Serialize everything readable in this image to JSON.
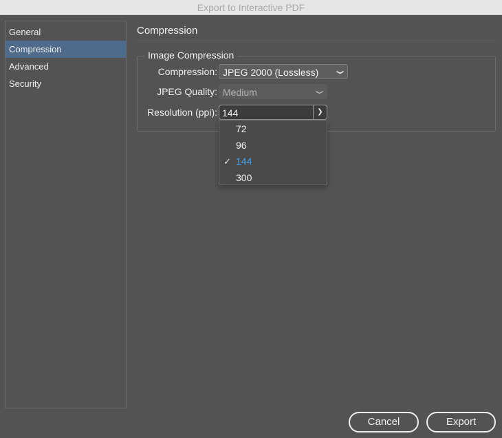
{
  "window": {
    "title": "Export to Interactive PDF"
  },
  "sidebar": {
    "items": [
      {
        "label": "General"
      },
      {
        "label": "Compression"
      },
      {
        "label": "Advanced"
      },
      {
        "label": "Security"
      }
    ],
    "active_index": 1
  },
  "panel": {
    "title": "Compression",
    "group_title": "Image Compression",
    "fields": {
      "compression": {
        "label": "Compression:",
        "value": "JPEG 2000 (Lossless)"
      },
      "jpeg_quality": {
        "label": "JPEG Quality:",
        "value": "Medium"
      },
      "resolution": {
        "label": "Resolution (ppi):",
        "value": "144"
      }
    },
    "resolution_options": [
      "72",
      "96",
      "144",
      "300"
    ],
    "resolution_selected": "144"
  },
  "icons": {
    "chevron": "chevron-down-icon",
    "check": "checkmark-icon"
  },
  "buttons": {
    "cancel": "Cancel",
    "export": "Export"
  },
  "colors": {
    "selection": "#4e6b8c",
    "selected_option": "#4aa3f0",
    "background": "#535353"
  }
}
